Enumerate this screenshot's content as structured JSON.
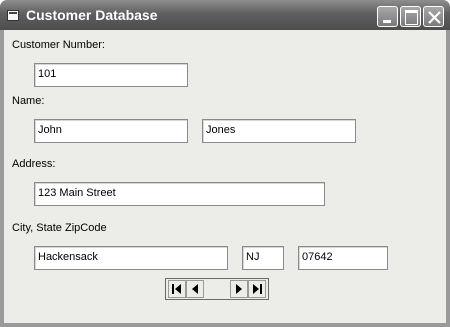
{
  "window": {
    "title": "Customer Database"
  },
  "form": {
    "customer_number_label": "Customer Number:",
    "customer_number_value": "101",
    "name_label": "Name:",
    "first_name_value": "John",
    "last_name_value": "Jones",
    "address_label": "Address:",
    "address_value": "123 Main Street",
    "city_state_zip_label": "City, State ZipCode",
    "city_value": "Hackensack",
    "state_value": "NJ",
    "zip_value": "07642"
  },
  "icons": {
    "app": "form-icon",
    "minimize": "minimize-icon",
    "maximize": "maximize-icon",
    "close": "close-icon",
    "first": "first-record-icon",
    "prev": "previous-record-icon",
    "next": "next-record-icon",
    "last": "last-record-icon"
  },
  "colors": {
    "titlebar": "#5f5f5f",
    "client_background": "#ecece8",
    "textbox_background": "#ffffff"
  }
}
